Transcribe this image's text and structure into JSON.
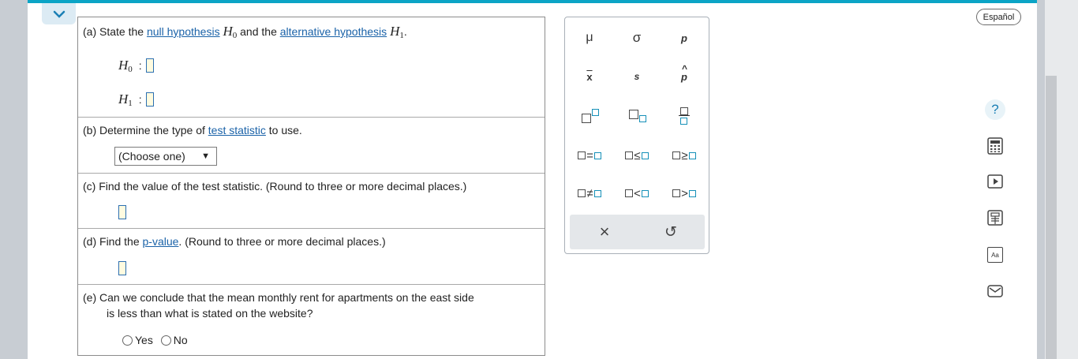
{
  "header": {
    "language_label": "Español"
  },
  "parts": {
    "a": {
      "tag": "(a)",
      "text1": "State the",
      "link1": "null hypothesis",
      "sym0": "H",
      "sub0": "0",
      "text2": "and the",
      "link2": "alternative hypothesis",
      "sym1": "H",
      "sub1": "1",
      "text3": ".",
      "h0_label": "H",
      "h0_sub": "0",
      "h1_label": "H",
      "h1_sub": "1",
      "colon": ":"
    },
    "b": {
      "tag": "(b)",
      "text1": "Determine the type of",
      "link": "test statistic",
      "text2": "to use.",
      "select_value": "(Choose one)",
      "select_arrow": "▼"
    },
    "c": {
      "tag": "(c)",
      "text": "Find the value of the test statistic. (Round to three or more decimal places.)"
    },
    "d": {
      "tag": "(d)",
      "text1": "Find the",
      "link": "p-value",
      "text2": ". (Round to three or more decimal places.)"
    },
    "e": {
      "tag": "(e)",
      "line1": "Can we conclude that the mean monthly rent for apartments on the east side",
      "line2": "is less than what is stated on the website?",
      "opt_yes": "Yes",
      "opt_no": "No"
    }
  },
  "palette": {
    "mu": "μ",
    "sigma": "σ",
    "p": "p",
    "xbar": "x",
    "s": "s",
    "phat": "p",
    "eq": "=",
    "le": "≤",
    "ge": "≥",
    "ne": "≠",
    "lt": "<",
    "gt": ">",
    "clear": "×",
    "undo": "↺"
  },
  "side_tools": {
    "help": "?",
    "textbook": "Aa"
  },
  "colors": {
    "accent": "#0ba4c6",
    "link": "#1a62a8",
    "answer_box_border": "#2c6fb1",
    "answer_box_fill": "#fffbe0"
  }
}
